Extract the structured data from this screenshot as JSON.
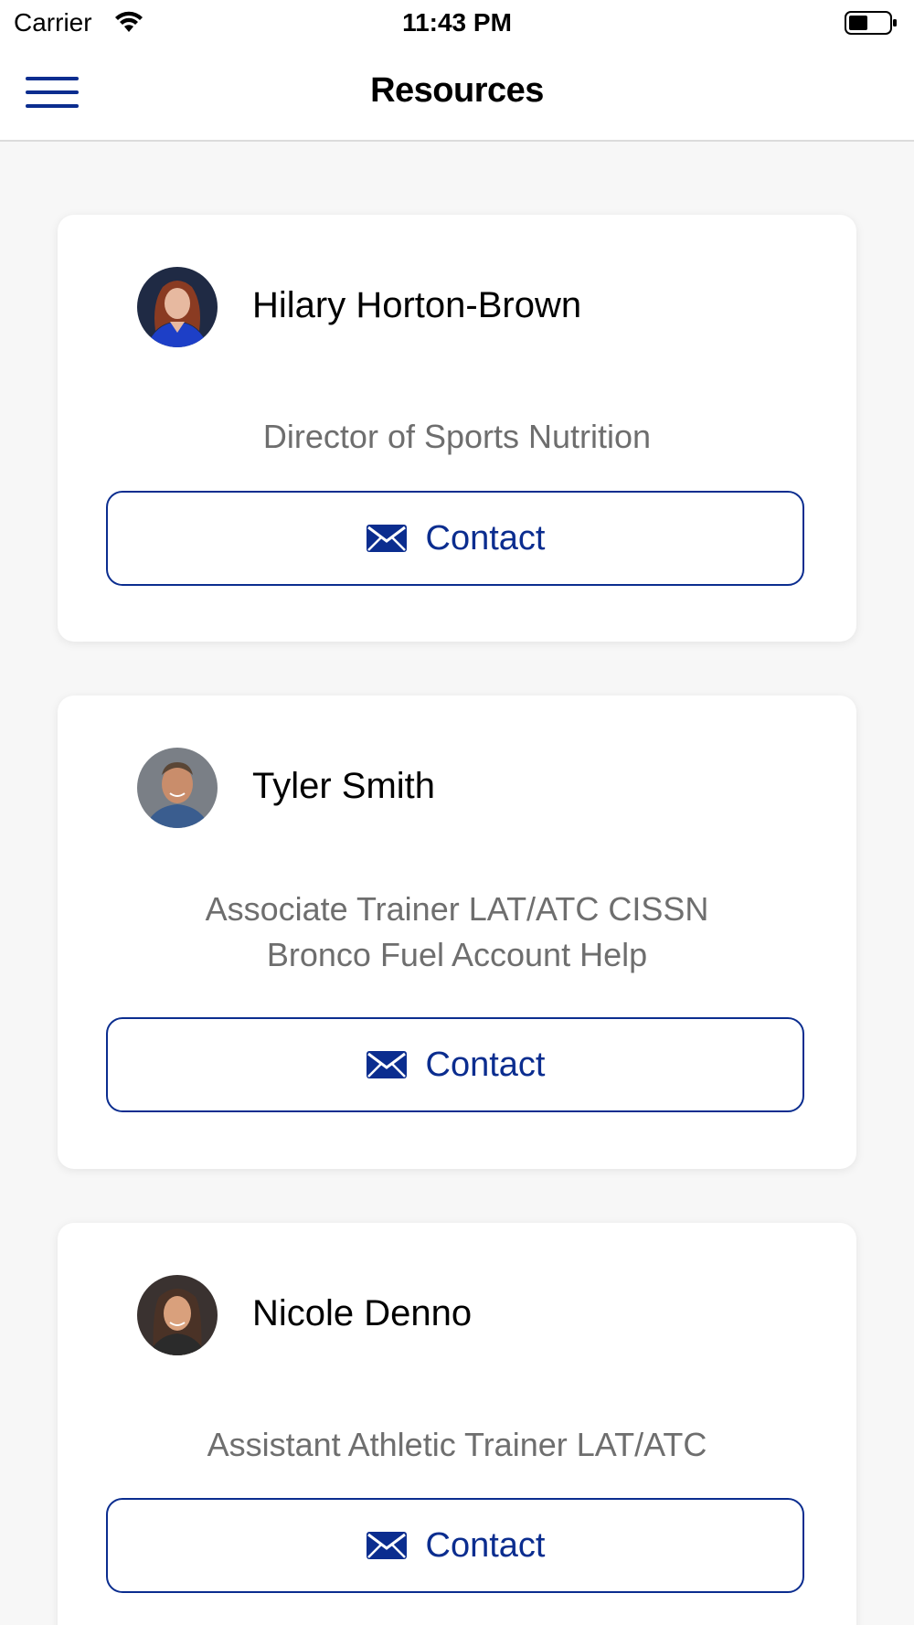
{
  "status_bar": {
    "carrier": "Carrier",
    "time": "11:43 PM",
    "icons": [
      "wifi-icon",
      "battery-icon"
    ]
  },
  "nav": {
    "title": "Resources",
    "menu_icon": "hamburger-menu-icon"
  },
  "colors": {
    "accent": "#0b2d8f",
    "role_text": "#6e6e6e",
    "background": "#f7f7f7"
  },
  "people": [
    {
      "name": "Hilary Horton-Brown",
      "role_lines": [
        "Director of Sports Nutrition"
      ],
      "contact_label": "Contact",
      "contact_icon": "mail-icon"
    },
    {
      "name": "Tyler Smith",
      "role_lines": [
        "Associate Trainer LAT/ATC CISSN",
        "Bronco Fuel Account Help"
      ],
      "contact_label": "Contact",
      "contact_icon": "mail-icon"
    },
    {
      "name": "Nicole Denno",
      "role_lines": [
        "Assistant Athletic Trainer LAT/ATC"
      ],
      "contact_label": "Contact",
      "contact_icon": "mail-icon"
    }
  ]
}
